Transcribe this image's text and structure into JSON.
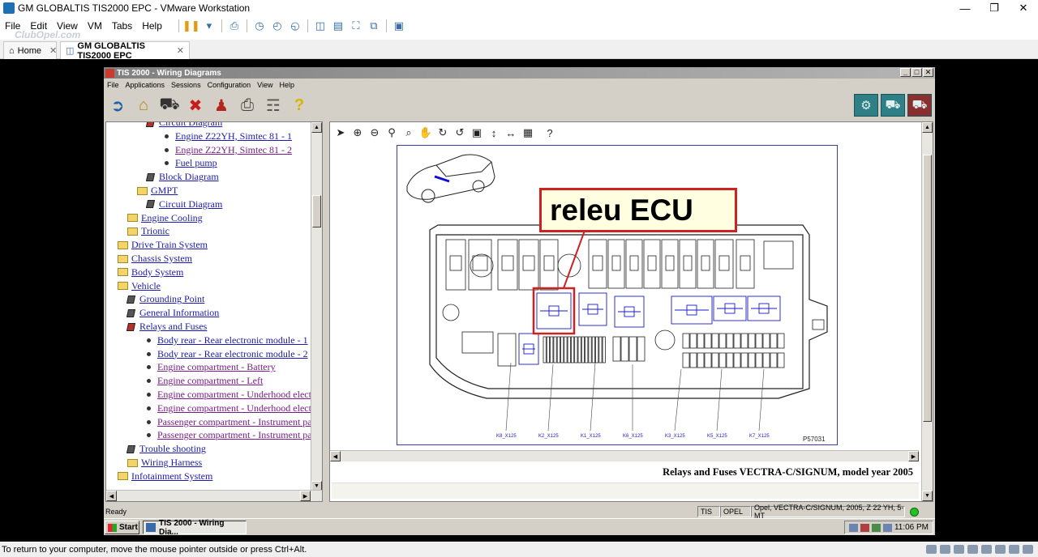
{
  "vmware": {
    "title": "GM GLOBALTIS TIS2000 EPC - VMware Workstation",
    "menu": [
      "File",
      "Edit",
      "View",
      "VM",
      "Tabs",
      "Help"
    ],
    "watermark": "ClubOpel.com",
    "tabs": [
      {
        "label": "Home"
      },
      {
        "label": "GM GLOBALTIS TIS2000 EPC"
      }
    ],
    "status_hint": "To return to your computer, move the mouse pointer outside or press Ctrl+Alt."
  },
  "guest": {
    "title": "TIS 2000 - Wiring Diagrams",
    "menu": [
      "File",
      "Applications",
      "Sessions",
      "Configuration",
      "View",
      "Help"
    ],
    "tree": [
      {
        "label": "Circuit Diagram",
        "icon": "book-red"
      },
      {
        "label": "Engine Z22YH, Simtec 81 - 1",
        "icon": "bullet"
      },
      {
        "label": "Engine Z22YH, Simtec 81 - 2",
        "icon": "bullet",
        "visited": true
      },
      {
        "label": "Fuel pump",
        "icon": "bullet"
      },
      {
        "label": "Block Diagram",
        "icon": "book"
      },
      {
        "label": "GMPT",
        "icon": "folder-open"
      },
      {
        "label": "Circuit Diagram",
        "icon": "book"
      },
      {
        "label": "Engine Cooling",
        "icon": "folder"
      },
      {
        "label": "Trionic",
        "icon": "folder"
      },
      {
        "label": "Drive Train System",
        "icon": "folder"
      },
      {
        "label": "Chassis System",
        "icon": "folder"
      },
      {
        "label": "Body System",
        "icon": "folder"
      },
      {
        "label": "Vehicle",
        "icon": "folder-open"
      },
      {
        "label": "Grounding Point",
        "icon": "book"
      },
      {
        "label": "General Information",
        "icon": "book"
      },
      {
        "label": "Relays and Fuses",
        "icon": "book-red"
      },
      {
        "label": "Body rear - Rear electronic module - 1",
        "icon": "bullet"
      },
      {
        "label": "Body rear - Rear electronic module - 2",
        "icon": "bullet"
      },
      {
        "label": "Engine compartment - Battery",
        "icon": "bullet",
        "visited": true
      },
      {
        "label": "Engine compartment - Left",
        "icon": "bullet",
        "visited": true
      },
      {
        "label": "Engine compartment - Underhood electric",
        "icon": "bullet",
        "visited": true
      },
      {
        "label": "Engine compartment - Underhood electric",
        "icon": "bullet",
        "visited": true
      },
      {
        "label": "Passenger compartment - Instrument pane",
        "icon": "bullet",
        "visited": true
      },
      {
        "label": "Passenger compartment - Instrument pane",
        "icon": "bullet",
        "visited": true
      },
      {
        "label": "Trouble shooting",
        "icon": "book"
      },
      {
        "label": "Wiring Harness",
        "icon": "folder"
      },
      {
        "label": "Infotainment System",
        "icon": "folder"
      }
    ],
    "diagram": {
      "callout": "releu ECU",
      "connectors": [
        "K8_X125",
        "K2_X125",
        "K1_X125",
        "K6_X125",
        "K3_X125",
        "K5_X125",
        "K7_X125"
      ],
      "figure_id": "P57031",
      "caption": "Relays and Fuses VECTRA-C/SIGNUM, model year 2005"
    },
    "status": {
      "ready": "Ready",
      "cells": [
        "TIS",
        "OPEL",
        "Opel, VECTRA-C/SIGNUM, 2005, Z 22 YH, 5-MT"
      ]
    },
    "taskbar": {
      "start": "Start",
      "task": "TIS 2000 - Wiring Dia...",
      "clock": "11:06 PM"
    }
  }
}
